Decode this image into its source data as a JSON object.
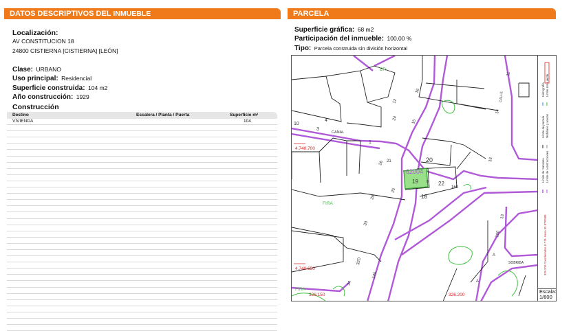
{
  "left_header": {
    "prefix": "DATOS DESCRIPTIVOS DEL ",
    "strong": "INMUEBLE"
  },
  "right_header": {
    "title": "PARCELA"
  },
  "localizacion": {
    "label": "Localización:",
    "line1": "AV CONSTITUCION 18",
    "line2": "24800 CISTIERNA [CISTIERNA] [LEÓN]"
  },
  "clase": {
    "label": "Clase:",
    "value": "URBANO"
  },
  "uso": {
    "label": "Uso principal:",
    "value": "Residencial"
  },
  "superficie": {
    "label": "Superficie construida:",
    "value": "104 m2"
  },
  "anio": {
    "label": "Año construcción:",
    "value": "1929"
  },
  "construccion": {
    "title": "Construcción",
    "headers": {
      "destino": "Destino",
      "escalera": "Escalera / Planta / Puerta",
      "superficie": "Superficie m²"
    },
    "rows": [
      {
        "destino": "VIVIENDA",
        "superficie": "104"
      }
    ]
  },
  "parcela": {
    "sup_label": "Superficie gráfica:",
    "sup_value": "68 m2",
    "part_label": "Participación del inmueble:",
    "part_value": "100,00 %",
    "tipo_label": "Tipo:",
    "tipo_value": "Parcela construida sin división horizontal"
  },
  "map": {
    "labels": {
      "er": "ER",
      "n10": "10",
      "n3": "3",
      "canal": "CANAL",
      "n1": "1",
      "n4": "4",
      "y740700": "4.740.700",
      "y740650": "4.740.650",
      "x326150": "326.150",
      "x326200": "326.200",
      "n20": "20",
      "n19": "19",
      "n22": "22",
      "n18": "18",
      "parcel_id": "62004",
      "n160": "160",
      "n8": "8",
      "n7": "7",
      "n21": "21",
      "n11": "11",
      "n14": "14",
      "calle": "CALLE",
      "n24": "24",
      "n15": "15",
      "n16": "16",
      "n12": "12",
      "n13": "13",
      "n26": "26",
      "n25": "25",
      "n28": "28",
      "n30": "30",
      "n32d": "32D",
      "n140": "140",
      "n34": "34",
      "fira1": "FIRA",
      "fira2": "FIRA",
      "a1": "A",
      "a2": "A",
      "sobriba": "SOBRIBA",
      "n120": "120",
      "n5": "5",
      "n6": "6",
      "n2": "2",
      "n9": "9"
    },
    "legend": {
      "manzana": "Límite de manzana",
      "construcciones": "Límite de construcciones",
      "parcela": "Límite de parcela",
      "mobiliario": "Mobiliario y aceras",
      "hidrografia": "Hidrografía",
      "zona_verde": "Límite zona verde",
      "coords": "326.200 Coordenadas U.T.M. Huso 30 ETRS89"
    },
    "scale_label": "Escala:",
    "scale_value": "1/800"
  },
  "colors": {
    "accent": "#f07a1a",
    "street": "#b05ad8",
    "green": "#3fbf3f",
    "coord": "#e02020"
  }
}
